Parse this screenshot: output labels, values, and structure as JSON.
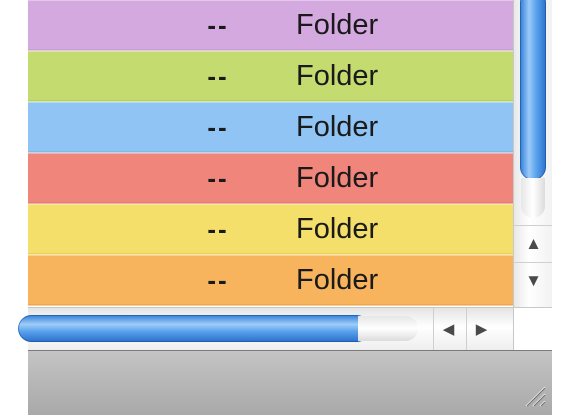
{
  "file_list": {
    "rows": [
      {
        "size": "--",
        "kind": "Folder",
        "label_color": "#d4a9e0"
      },
      {
        "size": "--",
        "kind": "Folder",
        "label_color": "#c3db6f"
      },
      {
        "size": "--",
        "kind": "Folder",
        "label_color": "#8fc4f4"
      },
      {
        "size": "--",
        "kind": "Folder",
        "label_color": "#f0857c"
      },
      {
        "size": "--",
        "kind": "Folder",
        "label_color": "#f3df6a"
      },
      {
        "size": "--",
        "kind": "Folder",
        "label_color": "#f7b45c"
      }
    ]
  },
  "scrollbars": {
    "vertical": {
      "up_icon": "arrow-up-icon",
      "down_icon": "arrow-down-icon",
      "scroll_position": 0.0
    },
    "horizontal": {
      "left_icon": "arrow-left-icon",
      "right_icon": "arrow-right-icon",
      "scroll_position": 0.0
    }
  },
  "status_bar": {
    "resize_icon": "resize-grip-icon"
  },
  "colors": {
    "scroll_thumb_blue": "#4a93e6",
    "status_bar_gray": "#b5b5b5"
  }
}
